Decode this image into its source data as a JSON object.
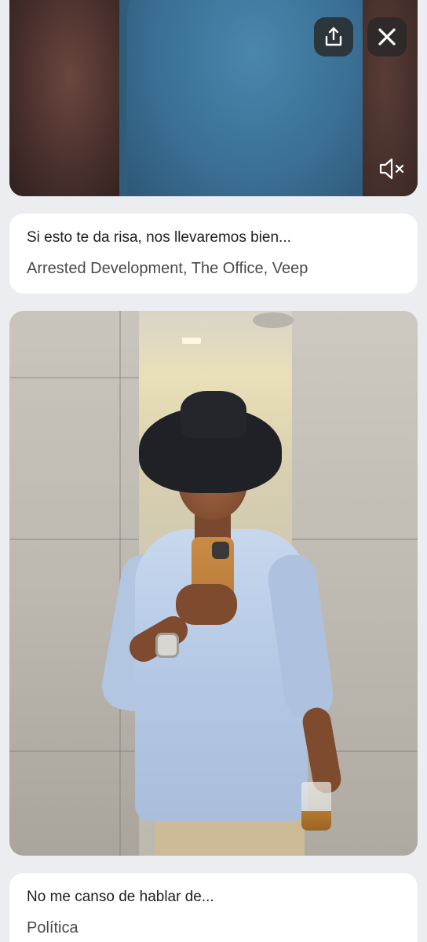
{
  "video_card": {
    "share_icon": "share-upload-icon",
    "close_icon": "close-x-icon",
    "mute_icon": "speaker-muted-icon"
  },
  "prompts": [
    {
      "question": "Si esto te da risa, nos llevaremos bien...",
      "answer": "Arrested Development, The Office, Veep"
    },
    {
      "question": "No me canso de hablar de...",
      "answer": "Política"
    }
  ],
  "colors": {
    "page_background": "#ecedf0",
    "card_background": "#ffffff",
    "overlay_button": "#2b2b2b"
  }
}
